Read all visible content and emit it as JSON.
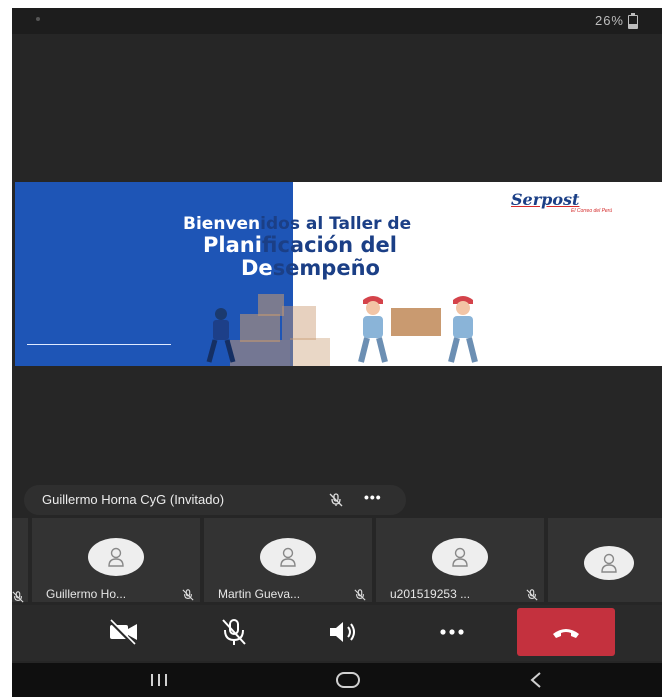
{
  "status_bar": {
    "battery": "26%",
    "battery_icon": "battery-icon"
  },
  "slide": {
    "logo": "Serpost",
    "logo_subtitle": "El Correo del Perú",
    "title_line1_part1": "Bienven",
    "title_line1_part2": "idos al Taller de",
    "title_line2_part1": "Plani",
    "title_line2_part2": "ficación del",
    "title_line3_part1": "De",
    "title_line3_part2": "sempeño",
    "colors": {
      "blue_panel": "#1e55b6",
      "title_dark": "#1b3f86",
      "logo_accent": "#d42a2a"
    }
  },
  "active_speaker": {
    "name": "Guillermo Horna CyG (Invitado)",
    "mic_icon": "mic-off-icon",
    "more": "•••"
  },
  "participants": [
    {
      "label": "Guillermo Ho...",
      "mic_icon": "mic-off-icon",
      "avatar_icon": "person-icon"
    },
    {
      "label": "Martin Gueva...",
      "mic_icon": "mic-off-icon",
      "avatar_icon": "person-icon"
    },
    {
      "label": "u201519253 ...",
      "mic_icon": "mic-off-icon",
      "avatar_icon": "person-icon"
    },
    {
      "label": "",
      "mic_icon": "",
      "avatar_icon": "person-icon"
    }
  ],
  "controls": {
    "camera": "camera-off-icon",
    "microphone": "mic-off-icon",
    "speaker": "speaker-icon",
    "more": "more-icon",
    "end_call": "phone-hangup-icon",
    "end_call_color": "#c4313e"
  },
  "navbar": {
    "recent": "recent-apps-icon",
    "home": "home-icon",
    "back": "back-icon"
  }
}
